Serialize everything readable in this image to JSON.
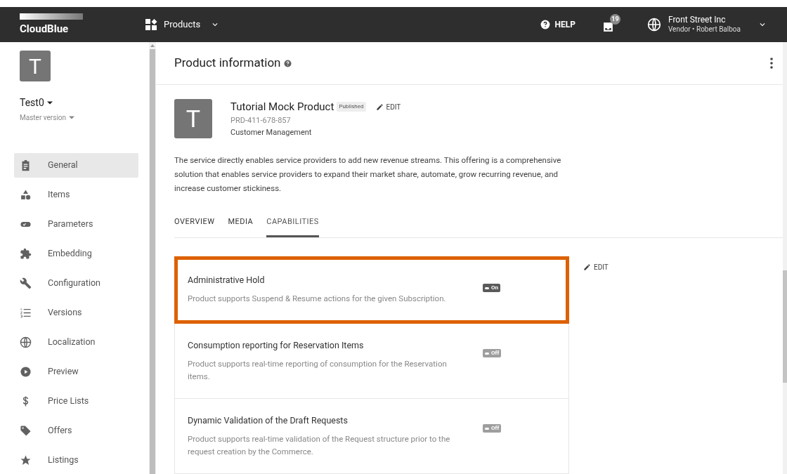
{
  "topbar": {
    "logo": "CloudBlue",
    "menu": "Products",
    "help": "HELP",
    "notification_count": "19",
    "account": {
      "name": "Front Street Inc",
      "role": "Vendor • Robert Balboa"
    }
  },
  "sidebar": {
    "avatar": "T",
    "product": "Test0",
    "version": "Master version",
    "items": [
      {
        "label": "General",
        "selected": true
      },
      {
        "label": "Items",
        "selected": false
      },
      {
        "label": "Parameters",
        "selected": false
      },
      {
        "label": "Embedding",
        "selected": false
      },
      {
        "label": "Configuration",
        "selected": false
      },
      {
        "label": "Versions",
        "selected": false
      },
      {
        "label": "Localization",
        "selected": false
      },
      {
        "label": "Preview",
        "selected": false
      },
      {
        "label": "Price Lists",
        "selected": false
      },
      {
        "label": "Offers",
        "selected": false
      },
      {
        "label": "Listings",
        "selected": false
      }
    ]
  },
  "page": {
    "title": "Product information",
    "product": {
      "avatar": "T",
      "name": "Tutorial Mock Product",
      "status": "Published",
      "edit": "EDIT",
      "id": "PRD-411-678-857",
      "category": "Customer Management",
      "description": "The service directly enables service providers to add new revenue streams. This offering is a comprehensive solution that enables service providers to expand their market share, automate, grow recurring revenue, and increase customer stickiness."
    },
    "tabs": [
      {
        "label": "OVERVIEW",
        "selected": false
      },
      {
        "label": "MEDIA",
        "selected": false
      },
      {
        "label": "CAPABILITIES",
        "selected": true
      }
    ],
    "capabilities_edit": "EDIT",
    "capabilities": [
      {
        "title": "Administrative Hold",
        "description": "Product supports Suspend & Resume actions for the given Subscription.",
        "on": true,
        "toggle": "On",
        "highlighted": true
      },
      {
        "title": "Consumption reporting for Reservation Items",
        "description": "Product supports real-time reporting of consumption for the Reservation items.",
        "on": false,
        "toggle": "Off",
        "highlighted": false
      },
      {
        "title": "Dynamic Validation of the Draft Requests",
        "description": "Product supports real-time validation of the Request structure prior to the request creation by the Commerce.",
        "on": false,
        "toggle": "Off",
        "highlighted": false
      }
    ]
  }
}
